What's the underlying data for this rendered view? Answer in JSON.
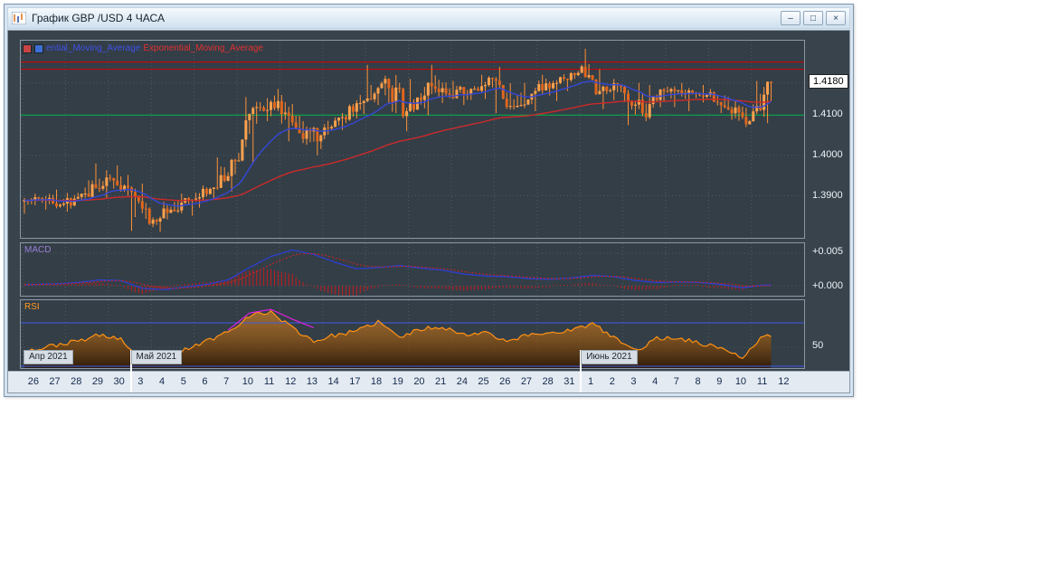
{
  "window": {
    "title": "График GBP /USD  4 ЧАСА",
    "controls": {
      "minimize": "–",
      "maximize": "□",
      "close": "×"
    }
  },
  "legend": {
    "ema_fast_label": "ential_Moving_Average",
    "ema_slow_label": "Exponential_Moving_Average"
  },
  "panels": {
    "macd_label": "MACD",
    "rsi_label": "RSI",
    "rsi_level_label": "50",
    "macd_scale": [
      "+0.005",
      "+0.000"
    ]
  },
  "price_scale": {
    "current": "1.4180",
    "labels": [
      "1.4100",
      "1.4000",
      "1.3900"
    ]
  },
  "months": [
    {
      "label": "Апр 2021",
      "day_index": 0
    },
    {
      "label": "Май 2021",
      "day_index": 5
    },
    {
      "label": "Июнь 2021",
      "day_index": 26
    }
  ],
  "colors": {
    "candle_up": "#ffa24d",
    "candle_down": "#e0661c",
    "wick": "#ff9136",
    "ema_fast": "#3548d8",
    "ema_slow": "#cc2a2a",
    "macd_line": "#2d3fd0",
    "macd_signal": "#d42222",
    "macd_hist": "#c21d1d",
    "rsi_line": "#ff9214",
    "rsi_levels": "#3f5be8",
    "rsi_ma": "#e020e0",
    "hline_red": "#d40000",
    "hline_green": "#00b84a",
    "grid": "#4f5c66"
  },
  "chart_data": {
    "type": "candlestick",
    "symbol": "GBP/USD",
    "timeframe": "4H",
    "x_labels": [
      "26",
      "27",
      "28",
      "29",
      "30",
      "3",
      "4",
      "5",
      "6",
      "7",
      "10",
      "11",
      "12",
      "13",
      "14",
      "17",
      "18",
      "19",
      "20",
      "21",
      "24",
      "25",
      "26",
      "27",
      "28",
      "31",
      "1",
      "2",
      "3",
      "4",
      "7",
      "8",
      "9",
      "10",
      "11",
      "12"
    ],
    "price": {
      "ylim": [
        1.3795,
        1.4285
      ],
      "grid_values": [
        1.418,
        1.41,
        1.4,
        1.39
      ],
      "hlines": [
        {
          "value": 1.4232,
          "color": "#d40000"
        },
        {
          "value": 1.4214,
          "color": "#d40000"
        },
        {
          "value": 1.41,
          "color": "#00b84a"
        }
      ],
      "daily_ohlc": [
        [
          1.3885,
          1.3905,
          1.3855,
          1.389
        ],
        [
          1.389,
          1.3915,
          1.3865,
          1.388
        ],
        [
          1.388,
          1.392,
          1.386,
          1.3905
        ],
        [
          1.3905,
          1.398,
          1.3895,
          1.3945
        ],
        [
          1.3945,
          1.3975,
          1.39,
          1.392
        ],
        [
          1.392,
          1.393,
          1.3812,
          1.383
        ],
        [
          1.383,
          1.3885,
          1.381,
          1.3865
        ],
        [
          1.3865,
          1.3905,
          1.385,
          1.389
        ],
        [
          1.389,
          1.3925,
          1.387,
          1.392
        ],
        [
          1.392,
          1.3995,
          1.391,
          1.3985
        ],
        [
          1.3985,
          1.4145,
          1.398,
          1.412
        ],
        [
          1.412,
          1.4165,
          1.4085,
          1.4135
        ],
        [
          1.4135,
          1.415,
          1.4035,
          1.4055
        ],
        [
          1.4055,
          1.4085,
          1.4,
          1.405
        ],
        [
          1.405,
          1.4105,
          1.404,
          1.4095
        ],
        [
          1.4095,
          1.415,
          1.408,
          1.4135
        ],
        [
          1.4135,
          1.4225,
          1.4125,
          1.419
        ],
        [
          1.419,
          1.42,
          1.406,
          1.411
        ],
        [
          1.411,
          1.419,
          1.41,
          1.418
        ],
        [
          1.418,
          1.4225,
          1.413,
          1.415
        ],
        [
          1.415,
          1.4185,
          1.4125,
          1.4165
        ],
        [
          1.4165,
          1.42,
          1.414,
          1.419
        ],
        [
          1.419,
          1.422,
          1.4105,
          1.412
        ],
        [
          1.412,
          1.418,
          1.411,
          1.416
        ],
        [
          1.416,
          1.42,
          1.4135,
          1.418
        ],
        [
          1.418,
          1.421,
          1.416,
          1.4205
        ],
        [
          1.4205,
          1.4265,
          1.415,
          1.416
        ],
        [
          1.416,
          1.419,
          1.4115,
          1.417
        ],
        [
          1.417,
          1.418,
          1.4075,
          1.4105
        ],
        [
          1.4105,
          1.4175,
          1.4085,
          1.416
        ],
        [
          1.416,
          1.418,
          1.412,
          1.4155
        ],
        [
          1.4155,
          1.4175,
          1.411,
          1.415
        ],
        [
          1.415,
          1.4165,
          1.4105,
          1.4115
        ],
        [
          1.4115,
          1.4135,
          1.407,
          1.4085
        ],
        [
          1.4085,
          1.4185,
          1.408,
          1.418
        ]
      ]
    },
    "macd": {
      "scale": [
        [
          "+0.005",
          0.005
        ],
        [
          "+0.000",
          0.0
        ]
      ],
      "daily_values": [
        0.0002,
        0.0003,
        0.0005,
        0.0009,
        0.0008,
        -0.0004,
        -0.0006,
        -0.0002,
        0.0002,
        0.0009,
        0.0028,
        0.0045,
        0.0055,
        0.0048,
        0.0036,
        0.0026,
        0.0028,
        0.0031,
        0.0027,
        0.0024,
        0.0018,
        0.0015,
        0.0014,
        0.0011,
        0.001,
        0.0012,
        0.0016,
        0.0014,
        0.0008,
        0.0005,
        0.0006,
        0.0005,
        0.0002,
        -0.0003,
        0.0001
      ]
    },
    "rsi": {
      "levels": [
        70,
        30
      ],
      "mid": 50,
      "daily_values": [
        48,
        52,
        55,
        60,
        57,
        35,
        40,
        48,
        55,
        63,
        76,
        79,
        66,
        55,
        60,
        63,
        71,
        58,
        65,
        67,
        60,
        63,
        55,
        60,
        62,
        64,
        69,
        58,
        47,
        57,
        58,
        53,
        50,
        41,
        60
      ],
      "ma_segment": {
        "start_day": 9,
        "values": [
          64,
          78,
          81,
          73,
          66
        ]
      }
    }
  }
}
